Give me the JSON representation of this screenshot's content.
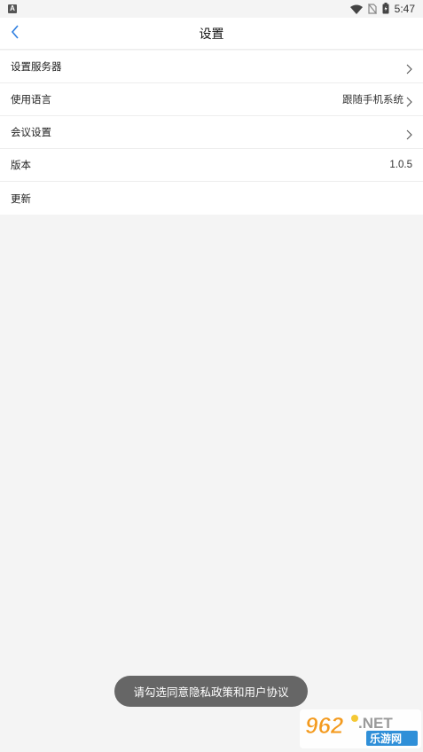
{
  "status_bar": {
    "notification_letter": "A",
    "time": "5:47",
    "icons": [
      "wifi-icon",
      "no-sim-icon",
      "battery-icon"
    ]
  },
  "header": {
    "title": "设置",
    "back_icon": "chevron-left-icon"
  },
  "settings": {
    "items": [
      {
        "label": "设置服务器",
        "value": "",
        "chevron": true
      },
      {
        "label": "使用语言",
        "value": "跟随手机系统",
        "chevron": true
      },
      {
        "label": "会议设置",
        "value": "",
        "chevron": true
      },
      {
        "label": "版本",
        "value": "1.0.5",
        "chevron": false
      },
      {
        "label": "更新",
        "value": "",
        "chevron": false
      }
    ]
  },
  "toast": {
    "message": "请勾选同意隐私政策和用户协议"
  },
  "watermark": {
    "brand": "962",
    "suffix": ".NET",
    "subtitle": "乐游网"
  },
  "colors": {
    "accent_blue": "#2f7fe0",
    "background": "#f4f4f4",
    "toast_bg": "#666666",
    "watermark_orange": "#f39a1e"
  }
}
